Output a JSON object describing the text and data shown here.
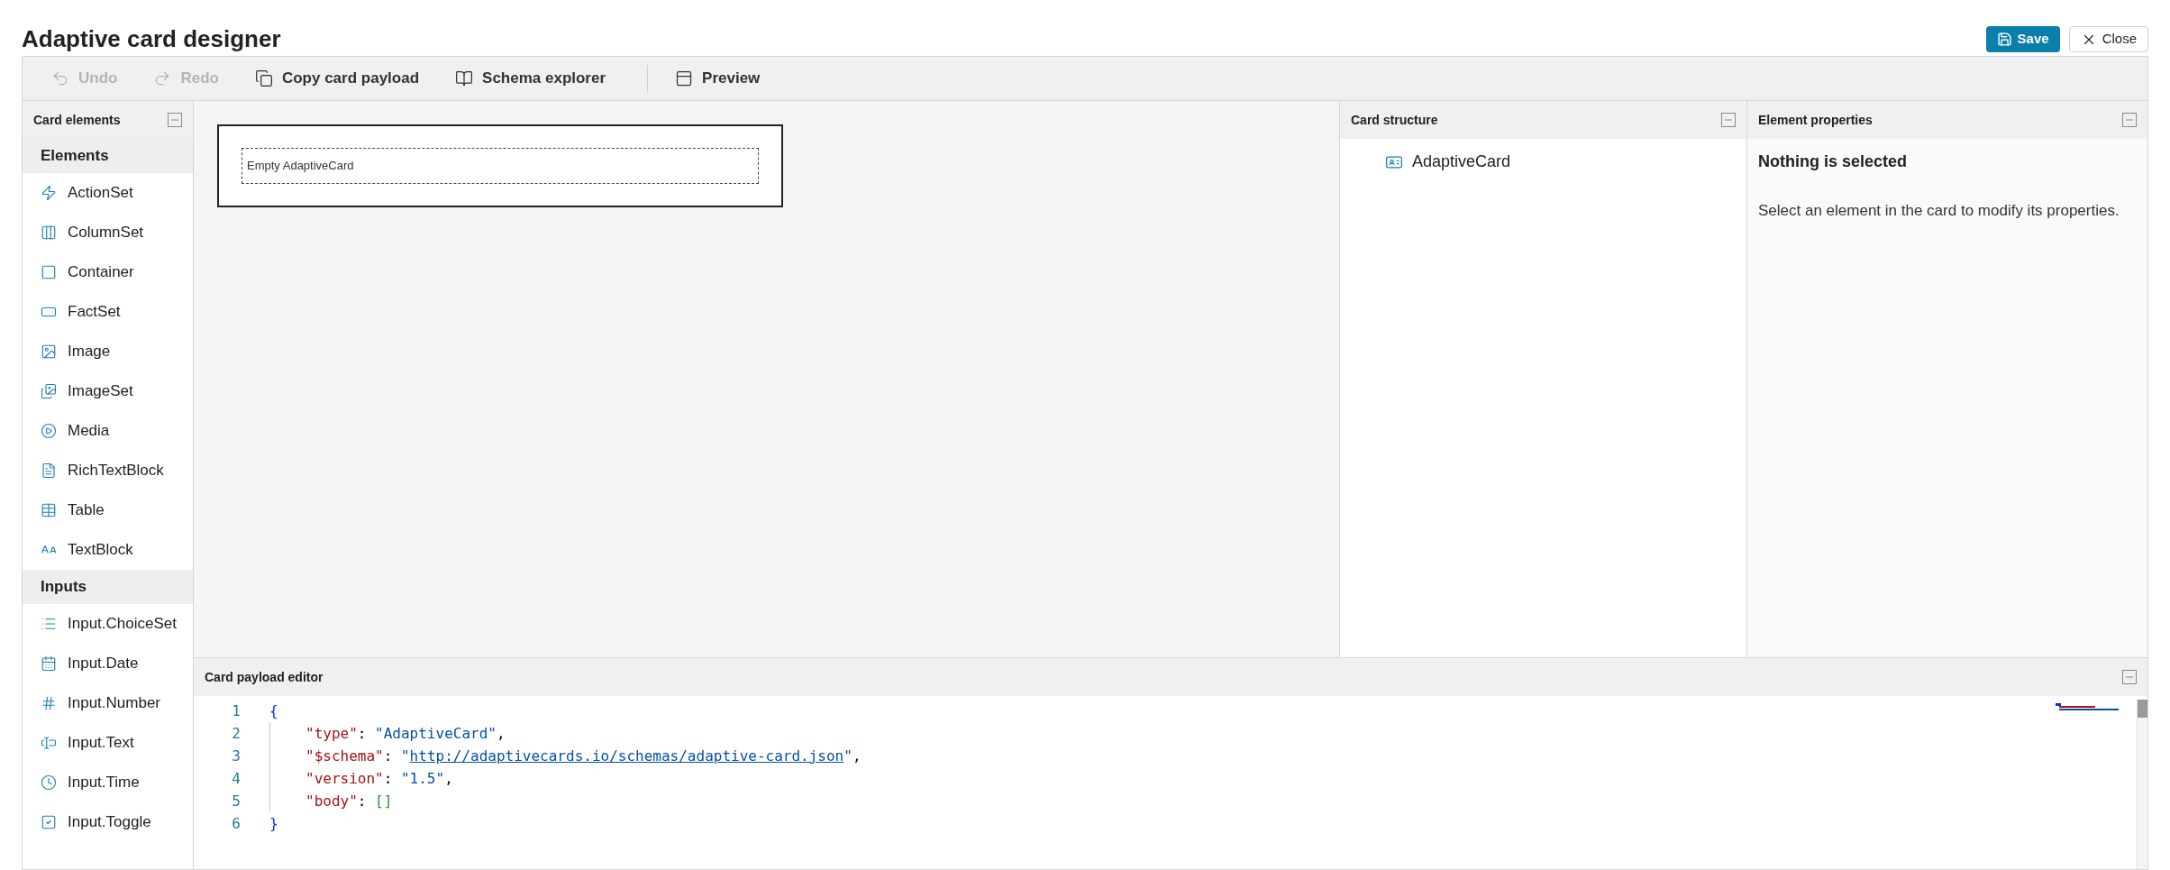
{
  "header": {
    "title": "Adaptive card designer",
    "buttons": [
      {
        "kind": "primary",
        "label": "Save"
      },
      {
        "kind": "secondary",
        "label": "Close"
      }
    ]
  },
  "toolbar": {
    "groups": [
      {
        "items": [
          {
            "label": "Undo",
            "disabled": true
          },
          {
            "label": "Redo",
            "disabled": true
          },
          {
            "label": "Copy card payload",
            "disabled": false
          },
          {
            "label": "Schema explorer",
            "disabled": false
          }
        ]
      },
      {
        "items": [
          {
            "label": "Preview",
            "disabled": false
          }
        ]
      }
    ]
  },
  "card_elements": {
    "title": "Card elements",
    "groups": [
      {
        "title": "Elements",
        "items": [
          "ActionSet",
          "ColumnSet",
          "Container",
          "FactSet",
          "Image",
          "ImageSet",
          "Media",
          "RichTextBlock",
          "Table",
          "TextBlock"
        ]
      },
      {
        "title": "Inputs",
        "items": [
          "Input.ChoiceSet",
          "Input.Date",
          "Input.Number",
          "Input.Text",
          "Input.Time",
          "Input.Toggle"
        ]
      }
    ]
  },
  "canvas": {
    "placeholder_text": "Empty AdaptiveCard"
  },
  "card_structure": {
    "title": "Card structure",
    "tree": [
      {
        "label": "AdaptiveCard"
      }
    ]
  },
  "element_properties": {
    "title": "Element properties",
    "heading": "Nothing is selected",
    "description": "Select an element in the card to modify its properties."
  },
  "payload_editor": {
    "title": "Card payload editor",
    "lines": [
      {
        "number": "1",
        "indented": false,
        "tokens": [
          {
            "kind": "brace",
            "text": "{"
          }
        ]
      },
      {
        "number": "2",
        "indented": true,
        "tokens": [
          {
            "kind": "key",
            "text": "\"type\""
          },
          {
            "kind": "punct",
            "text": ": "
          },
          {
            "kind": "string",
            "text": "\"AdaptiveCard\""
          },
          {
            "kind": "punct",
            "text": ","
          }
        ]
      },
      {
        "number": "3",
        "indented": true,
        "tokens": [
          {
            "kind": "key",
            "text": "\"$schema\""
          },
          {
            "kind": "punct",
            "text": ": "
          },
          {
            "kind": "string",
            "text": "\""
          },
          {
            "kind": "link",
            "text": "http://adaptivecards.io/schemas/adaptive-card.json"
          },
          {
            "kind": "string",
            "text": "\""
          },
          {
            "kind": "punct",
            "text": ","
          }
        ]
      },
      {
        "number": "4",
        "indented": true,
        "tokens": [
          {
            "kind": "key",
            "text": "\"version\""
          },
          {
            "kind": "punct",
            "text": ": "
          },
          {
            "kind": "string",
            "text": "\"1.5\""
          },
          {
            "kind": "punct",
            "text": ","
          }
        ]
      },
      {
        "number": "5",
        "indented": true,
        "tokens": [
          {
            "kind": "key",
            "text": "\"body\""
          },
          {
            "kind": "punct",
            "text": ": "
          },
          {
            "kind": "array",
            "text": "[]"
          }
        ]
      },
      {
        "number": "6",
        "indented": false,
        "tokens": [
          {
            "kind": "brace",
            "text": "}"
          }
        ]
      }
    ]
  }
}
